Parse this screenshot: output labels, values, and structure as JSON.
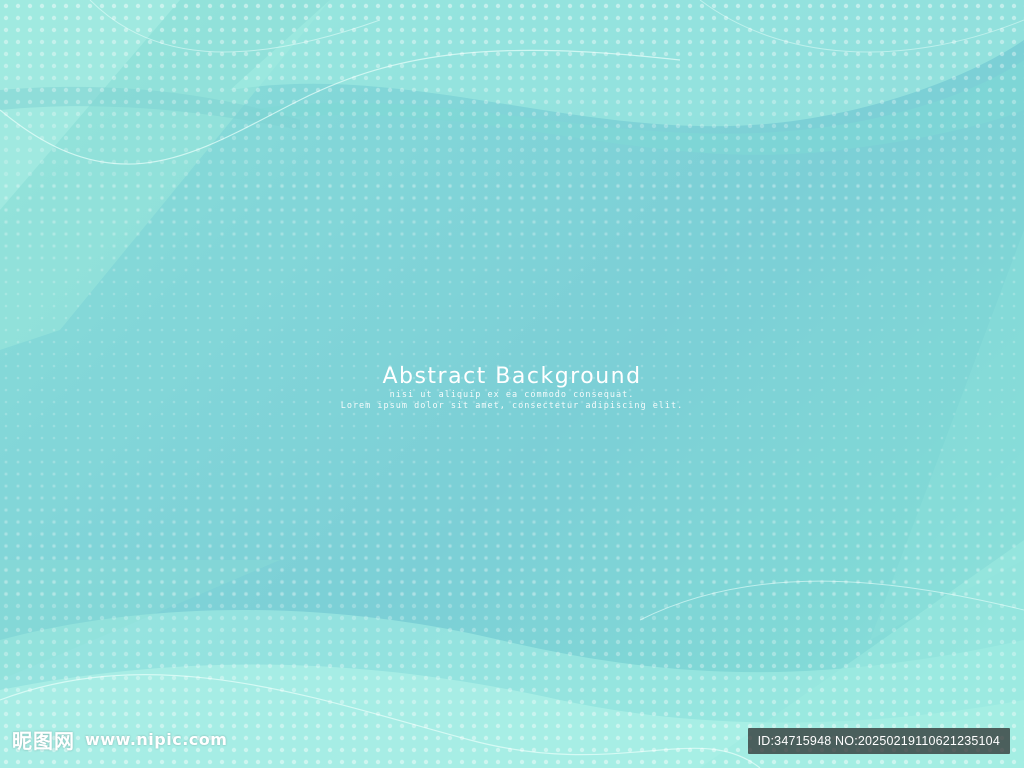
{
  "headline": {
    "title": "Abstract Background",
    "line1": "nisi ut aliquip ex ea commodo consequat.",
    "line2": "Lorem ipsum dolor sit amet, consectetur adipiscing elit."
  },
  "watermark": {
    "site_name": "昵图网",
    "site_url": "www.nipic.com",
    "image_id_text": "ID:34715948 NO:20250219110621235104"
  },
  "colors": {
    "base": "#7fd3d3",
    "light_wave": "#a6f0e4",
    "dark_wave": "#6fcfcf",
    "text": "#ffffff",
    "badge_bg": "#282828"
  }
}
